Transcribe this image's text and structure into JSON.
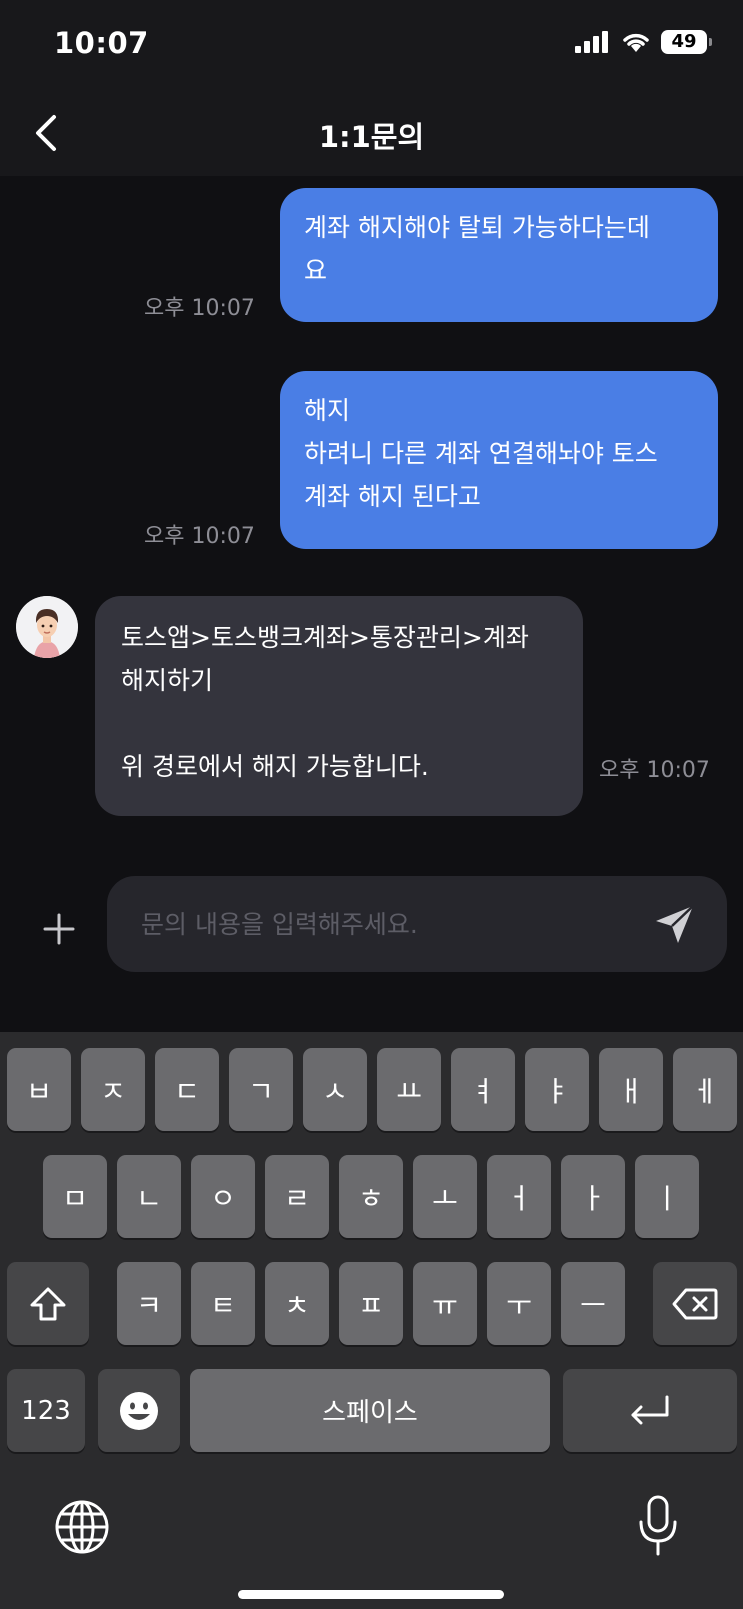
{
  "status_bar": {
    "time": "10:07",
    "battery": "49"
  },
  "header": {
    "title": "1:1문의"
  },
  "messages": [
    {
      "sender": "me",
      "text": "계좌 해지해야 탈퇴 가능하다는데\n요",
      "time": "오후 10:07"
    },
    {
      "sender": "me",
      "text": "해지\n하려니 다른 계좌 연결해놔야 토스\n계좌 해지 된다고",
      "time": "오후 10:07"
    },
    {
      "sender": "agent",
      "text": "토스앱>토스뱅크계좌>통장관리>계좌\n해지하기\n\n위 경로에서 해지 가능합니다.",
      "time": "오후 10:07"
    }
  ],
  "composer": {
    "placeholder": "문의 내용을 입력해주세요.",
    "value": ""
  },
  "keyboard": {
    "row1": [
      "ㅂ",
      "ㅈ",
      "ㄷ",
      "ㄱ",
      "ㅅ",
      "ㅛ",
      "ㅕ",
      "ㅑ",
      "ㅐ",
      "ㅔ"
    ],
    "row2": [
      "ㅁ",
      "ㄴ",
      "ㅇ",
      "ㄹ",
      "ㅎ",
      "ㅗ",
      "ㅓ",
      "ㅏ",
      "ㅣ"
    ],
    "row3": [
      "ㅋ",
      "ㅌ",
      "ㅊ",
      "ㅍ",
      "ㅠ",
      "ㅜ",
      "ㅡ"
    ],
    "numbers_label": "123",
    "space_label": "스페이스"
  }
}
